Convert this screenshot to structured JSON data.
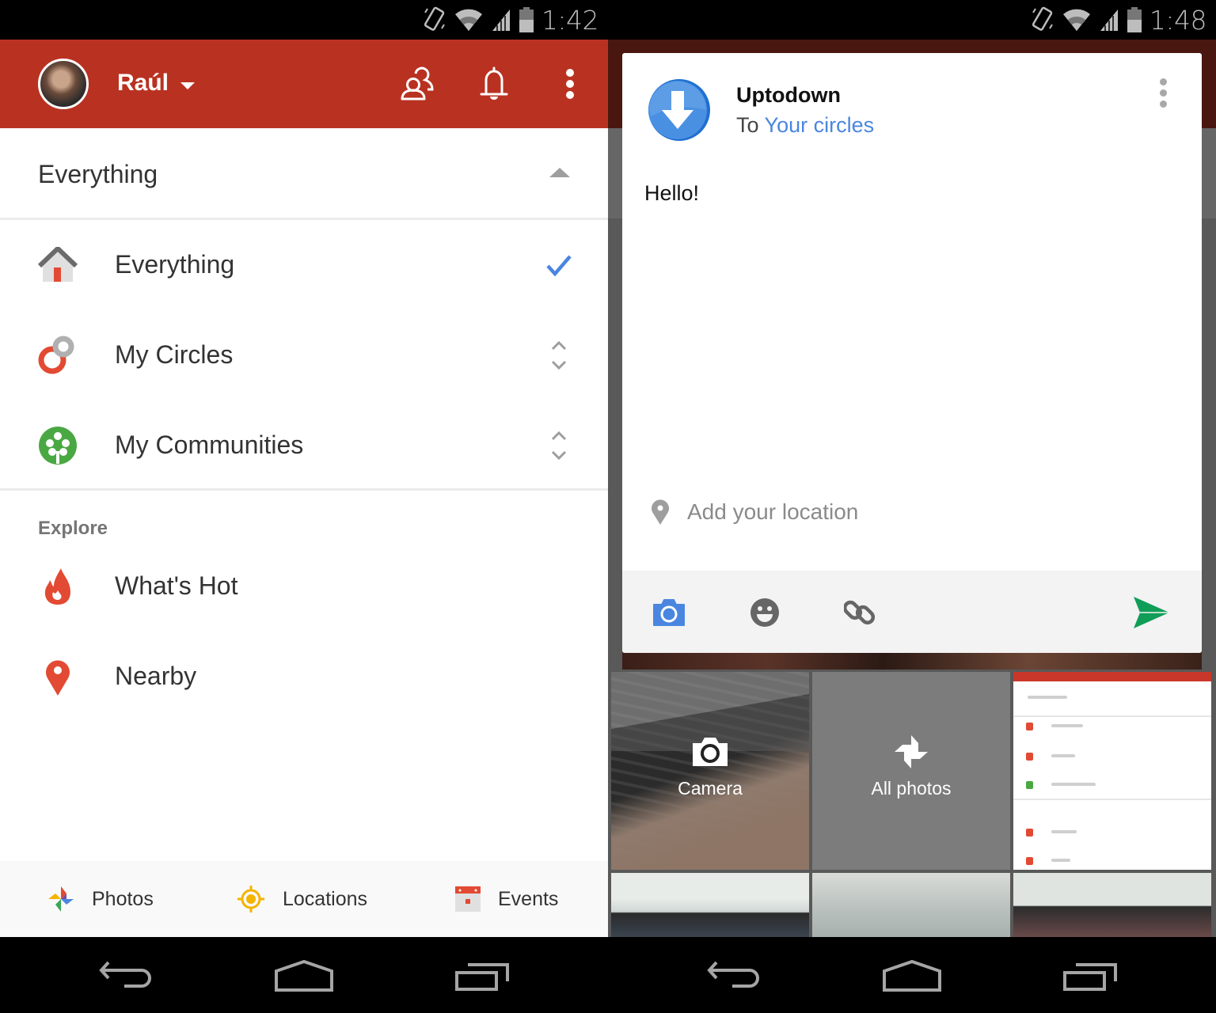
{
  "left_screen": {
    "status_bar": {
      "time": "1:42",
      "icons": [
        "rotation-icon",
        "wifi-icon",
        "signal-icon",
        "battery-icon"
      ]
    },
    "app_bar": {
      "account_name": "Raúl",
      "actions": [
        {
          "name": "circles-icon",
          "label": "Circles"
        },
        {
          "name": "notifications-icon",
          "label": "Notifications"
        },
        {
          "name": "overflow-menu-icon",
          "label": "More options"
        }
      ],
      "brand_color": "#b93221"
    },
    "stream_selector": {
      "current": "Everything",
      "expanded": true
    },
    "streams": [
      {
        "label": "Everything",
        "icon": "home-icon",
        "selected": true,
        "trailing": "checkmark-icon"
      },
      {
        "label": "My Circles",
        "icon": "circles-icon",
        "selected": false,
        "trailing": "expand-icon"
      },
      {
        "label": "My Communities",
        "icon": "communities-icon",
        "selected": false,
        "trailing": "expand-icon"
      }
    ],
    "explore": {
      "heading": "Explore",
      "items": [
        {
          "label": "What's Hot",
          "icon": "flame-icon"
        },
        {
          "label": "Nearby",
          "icon": "map-pin-icon"
        }
      ]
    },
    "bottom_bar": [
      {
        "label": "Photos",
        "icon": "pinwheel-icon"
      },
      {
        "label": "Locations",
        "icon": "location-target-icon"
      },
      {
        "label": "Events",
        "icon": "calendar-icon"
      }
    ],
    "nav_bar": [
      "back",
      "home",
      "recents"
    ]
  },
  "right_screen": {
    "status_bar": {
      "time": "1:48",
      "icons": [
        "rotation-icon",
        "wifi-icon",
        "signal-icon",
        "battery-icon"
      ]
    },
    "compose_card": {
      "author": "Uptodown",
      "audience_prefix": "To",
      "audience": "Your circles",
      "post_text": "Hello!",
      "location_placeholder": "Add your location",
      "toolbar": [
        "camera-icon",
        "emoji-icon",
        "link-icon"
      ],
      "send_label": "Send",
      "accent_color": "#4a86e0",
      "send_color": "#0f9d58"
    },
    "photo_picker": {
      "tiles": [
        {
          "label": "Camera",
          "icon": "camera-icon"
        },
        {
          "label": "All photos",
          "icon": "pinwheel-icon"
        },
        {
          "label": "",
          "type": "screenshot"
        },
        {
          "label": "",
          "type": "photo"
        },
        {
          "label": "",
          "type": "photo"
        },
        {
          "label": "",
          "type": "photo"
        }
      ]
    },
    "nav_bar": [
      "back",
      "home",
      "recents"
    ]
  }
}
